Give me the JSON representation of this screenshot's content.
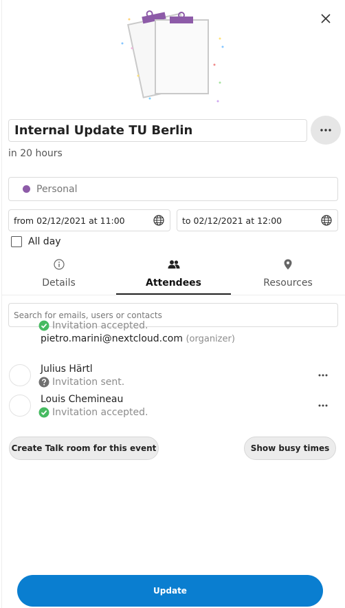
{
  "event": {
    "title": "Internal Update TU Berlin",
    "relative_time": "in 20 hours",
    "calendar": {
      "name": "Personal",
      "color": "#8d5ba8"
    },
    "from": "from 02/12/2021 at 11:00",
    "to": "to 02/12/2021 at 12:00",
    "all_day_label": "All day",
    "all_day_checked": false
  },
  "icons": {
    "close": "close-icon",
    "more": "more-horizontal-icon",
    "timezone": "globe-icon",
    "details": "info-icon",
    "attendees": "people-icon",
    "resources": "location-pin-icon"
  },
  "tabs": [
    {
      "label": "Details",
      "active": false
    },
    {
      "label": "Attendees",
      "active": true
    },
    {
      "label": "Resources",
      "active": false
    }
  ],
  "attendees_panel": {
    "search_placeholder": "Search for emails, users or contacts",
    "organizer": {
      "status": "Invitation accepted.",
      "email": "pietro.marini@nextcloud.com",
      "tag": "(organizer)"
    },
    "attendees": [
      {
        "name": "Julius Härtl",
        "status": "Invitation sent.",
        "status_kind": "pending"
      },
      {
        "name": "Louis Chemineau",
        "status": "Invitation accepted.",
        "status_kind": "accepted"
      }
    ]
  },
  "actions": {
    "create_talk_room": "Create Talk room for this event",
    "show_busy_times": "Show busy times",
    "update": "Update"
  },
  "colors": {
    "primary": "#0a7ed0",
    "accepted": "#46ba61",
    "pending": "#6f6f6f",
    "accent_purple": "#8d5ba8"
  }
}
